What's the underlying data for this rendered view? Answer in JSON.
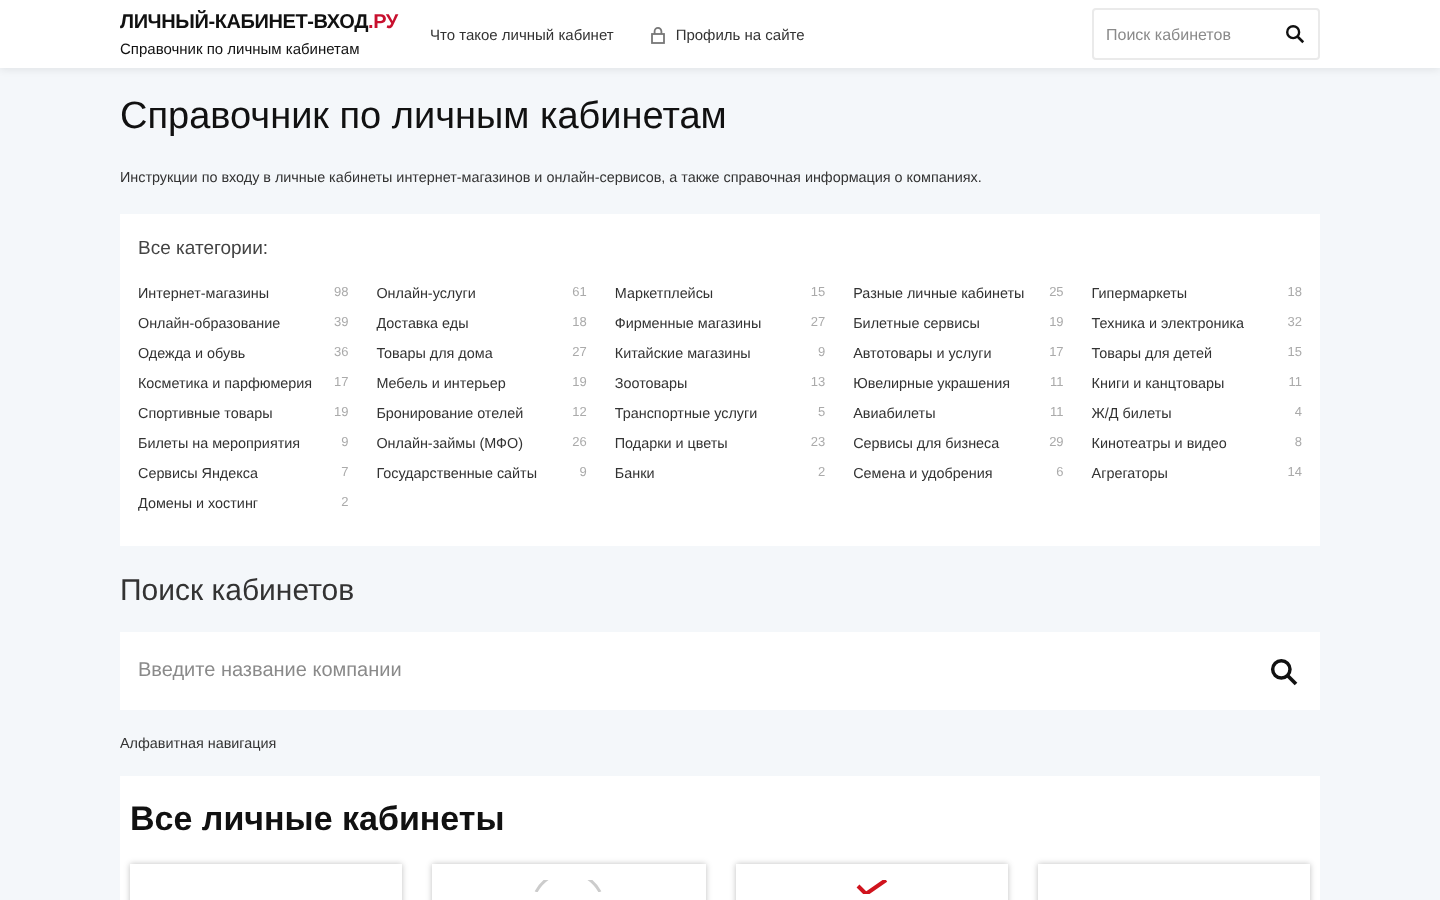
{
  "header": {
    "logo": {
      "name": "ЛИЧНЫЙ-КАБИНЕТ-ВХОД",
      "tld": ".РУ"
    },
    "tagline": "Справочник по личным кабинетам",
    "nav": [
      {
        "label": "Что такое личный кабинет",
        "kind": "plain"
      },
      {
        "label": "Профиль на сайте",
        "kind": "lock"
      }
    ],
    "search": {
      "placeholder": "Поиск кабинетов"
    }
  },
  "page": {
    "title": "Справочник по личным кабинетам",
    "description": "Инструкции по входу в личные кабинеты интернет-магазинов и онлайн-сервисов, а также справочная информация о компаниях."
  },
  "categories": {
    "title": "Все категории:",
    "columns": [
      [
        {
          "name": "Интернет-магазины",
          "count": "98"
        },
        {
          "name": "Онлайн-образование",
          "count": "39"
        },
        {
          "name": "Одежда и обувь",
          "count": "36"
        },
        {
          "name": "Косметика и парфюмерия",
          "count": "17"
        },
        {
          "name": "Спортивные товары",
          "count": "19"
        },
        {
          "name": "Билеты на мероприятия",
          "count": "9"
        },
        {
          "name": "Сервисы Яндекса",
          "count": "7"
        },
        {
          "name": "Домены и хостинг",
          "count": "2"
        }
      ],
      [
        {
          "name": "Онлайн-услуги",
          "count": "61"
        },
        {
          "name": "Доставка еды",
          "count": "18"
        },
        {
          "name": "Товары для дома",
          "count": "27"
        },
        {
          "name": "Мебель и интерьер",
          "count": "19"
        },
        {
          "name": "Бронирование отелей",
          "count": "12"
        },
        {
          "name": "Онлайн-займы (МФО)",
          "count": "26"
        },
        {
          "name": "Государственные сайты",
          "count": "9"
        }
      ],
      [
        {
          "name": "Маркетплейсы",
          "count": "15"
        },
        {
          "name": "Фирменные магазины",
          "count": "27"
        },
        {
          "name": "Китайские магазины",
          "count": "9"
        },
        {
          "name": "Зоотовары",
          "count": "13"
        },
        {
          "name": "Транспортные услуги",
          "count": "5"
        },
        {
          "name": "Подарки и цветы",
          "count": "23"
        },
        {
          "name": "Банки",
          "count": "2"
        }
      ],
      [
        {
          "name": "Разные личные кабинеты",
          "count": "25"
        },
        {
          "name": "Билетные сервисы",
          "count": "19"
        },
        {
          "name": "Автотовары и услуги",
          "count": "17"
        },
        {
          "name": "Ювелирные украшения",
          "count": "11"
        },
        {
          "name": "Авиабилеты",
          "count": "11"
        },
        {
          "name": "Сервисы для бизнеса",
          "count": "29"
        },
        {
          "name": "Семена и удобрения",
          "count": "6"
        }
      ],
      [
        {
          "name": "Гипермаркеты",
          "count": "18"
        },
        {
          "name": "Техника и электроника",
          "count": "32"
        },
        {
          "name": "Товары для детей",
          "count": "15"
        },
        {
          "name": "Книги и канцтовары",
          "count": "11"
        },
        {
          "name": "Ж/Д билеты",
          "count": "4"
        },
        {
          "name": "Кинотеатры и видео",
          "count": "8"
        },
        {
          "name": "Агрегаторы",
          "count": "14"
        }
      ]
    ]
  },
  "search_section": {
    "title": "Поиск кабинетов",
    "placeholder": "Введите название компании",
    "alpha_link": "Алфавитная навигация"
  },
  "cabinets": {
    "title": "Все личные кабинеты",
    "cards": [
      {
        "kind": "blank"
      },
      {
        "kind": "circle"
      },
      {
        "kind": "check"
      },
      {
        "kind": "blank"
      }
    ]
  }
}
